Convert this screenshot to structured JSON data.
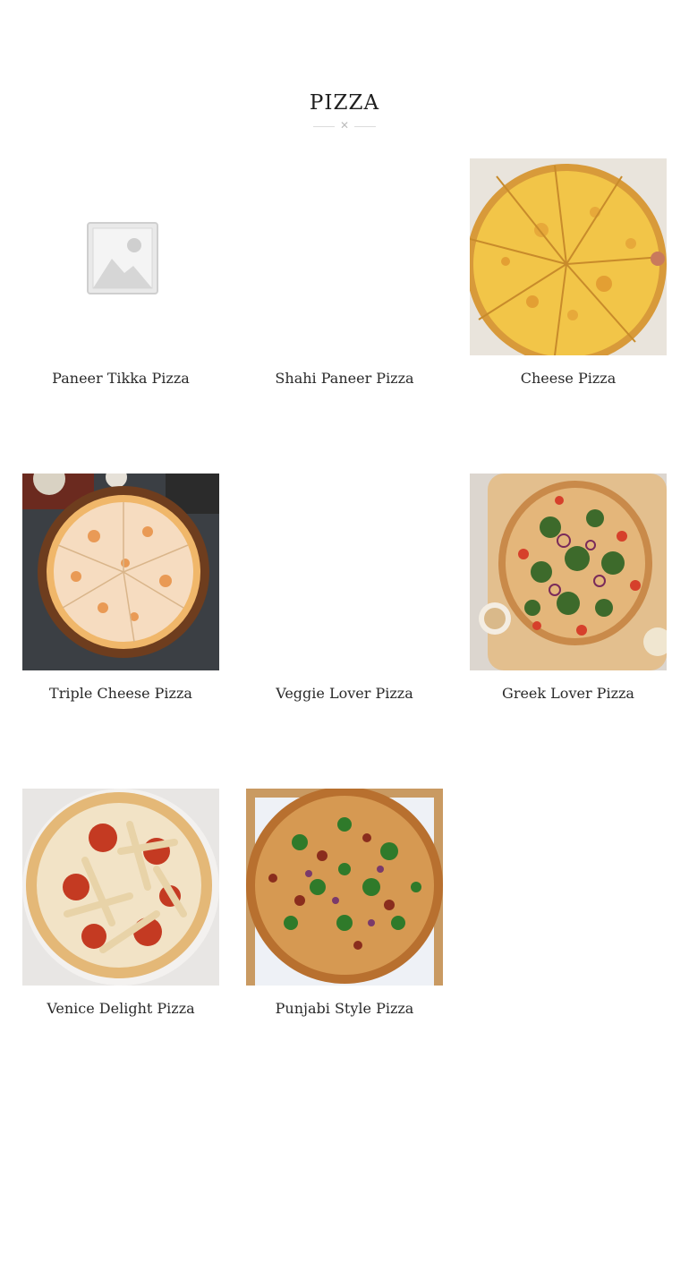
{
  "section": {
    "title": "PIZZA"
  },
  "products": [
    {
      "name": "Paneer Tikka Pizza",
      "image": "placeholder-icon"
    },
    {
      "name": "Shahi Paneer Pizza",
      "image": "none"
    },
    {
      "name": "Cheese Pizza",
      "image": "cheese-pizza-photo"
    },
    {
      "name": "Triple Cheese Pizza",
      "image": "triple-cheese-pizza-photo"
    },
    {
      "name": "Veggie Lover Pizza",
      "image": "none"
    },
    {
      "name": "Greek Lover Pizza",
      "image": "greek-pizza-photo"
    },
    {
      "name": "Venice Delight Pizza",
      "image": "pepperoni-chicken-pizza-photo"
    },
    {
      "name": "Punjabi Style Pizza",
      "image": "punjabi-pizza-photo"
    }
  ]
}
